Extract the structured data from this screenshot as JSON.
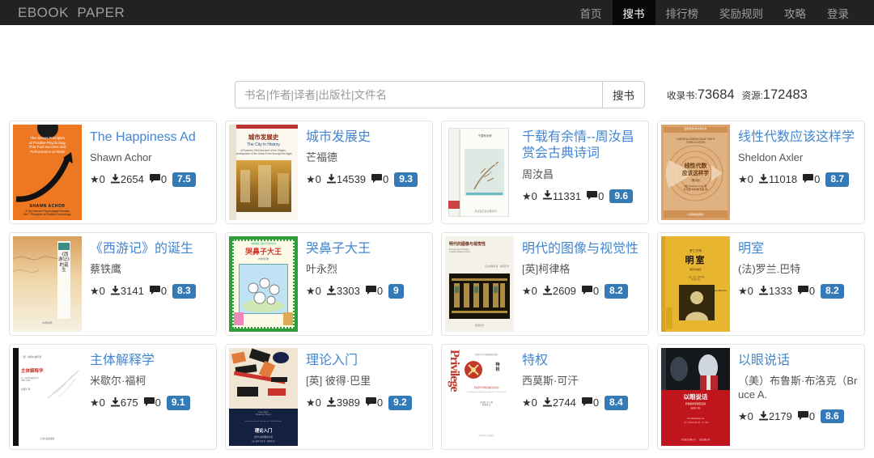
{
  "navbar": {
    "brand": "EBOOK  PAPER",
    "links": [
      {
        "label": "首页",
        "active": false
      },
      {
        "label": "搜书",
        "active": true
      },
      {
        "label": "排行榜",
        "active": false
      },
      {
        "label": "奖励规则",
        "active": false
      },
      {
        "label": "攻略",
        "active": false
      },
      {
        "label": "登录",
        "active": false
      }
    ]
  },
  "search": {
    "placeholder": "书名|作者|译者|出版社|文件名",
    "value": "",
    "button_label": "搜书",
    "stats": {
      "books_label": "收录书:",
      "books_count": "73684",
      "resources_label": "资源:",
      "resources_count": "172483"
    }
  },
  "colors": {
    "link": "#4286d0",
    "badge": "#337ab7",
    "navbar_bg": "#222222",
    "nav_active_bg": "#080808"
  },
  "icons": {
    "star": "★",
    "download": "⤓",
    "comment": "🗨"
  },
  "books": [
    {
      "title": "The Happiness Ad",
      "author": "Shawn Achor",
      "stars": "0",
      "downloads": "2654",
      "comments": "0",
      "rating": "7.5",
      "cover_style": "happiness"
    },
    {
      "title": "城市发展史",
      "author": "芒福德",
      "stars": "0",
      "downloads": "14539",
      "comments": "0",
      "rating": "9.3",
      "cover_style": "city"
    },
    {
      "title": "千载有余情--周汝昌赏会古典诗词",
      "author": "周汝昌",
      "stars": "0",
      "downloads": "11331",
      "comments": "0",
      "rating": "9.6",
      "cover_style": "poetry"
    },
    {
      "title": "线性代数应该这样学",
      "author": "Sheldon Axler",
      "stars": "0",
      "downloads": "11018",
      "comments": "0",
      "rating": "8.7",
      "cover_style": "linear"
    },
    {
      "title": "《西游记》的诞生",
      "author": "蔡铁鹰",
      "stars": "0",
      "downloads": "3141",
      "comments": "0",
      "rating": "8.3",
      "cover_style": "xiyouji"
    },
    {
      "title": "哭鼻子大王",
      "author": "叶永烈",
      "stars": "0",
      "downloads": "3303",
      "comments": "0",
      "rating": "9",
      "cover_style": "kubizi"
    },
    {
      "title": "明代的图像与视觉性",
      "author": "[英]柯律格",
      "stars": "0",
      "downloads": "2609",
      "comments": "0",
      "rating": "8.2",
      "cover_style": "mingdai"
    },
    {
      "title": "明室",
      "author": "(法)罗兰.巴特",
      "stars": "0",
      "downloads": "1333",
      "comments": "0",
      "rating": "8.2",
      "cover_style": "mingshi"
    },
    {
      "title": "主体解释学",
      "author": "米歇尔·福柯",
      "stars": "0",
      "downloads": "675",
      "comments": "0",
      "rating": "9.1",
      "cover_style": "zhuti"
    },
    {
      "title": "理论入门",
      "author": "[英] 彼得·巴里",
      "stars": "0",
      "downloads": "3989",
      "comments": "0",
      "rating": "9.2",
      "cover_style": "lilun"
    },
    {
      "title": "特权",
      "author": "西莫斯·可汗",
      "stars": "0",
      "downloads": "2744",
      "comments": "0",
      "rating": "8.4",
      "cover_style": "privilege"
    },
    {
      "title": "以眼说话",
      "author": "（美）布鲁斯·布洛克（Bruce A.",
      "stars": "0",
      "downloads": "2179",
      "comments": "0",
      "rating": "8.6",
      "cover_style": "yiyan"
    }
  ]
}
